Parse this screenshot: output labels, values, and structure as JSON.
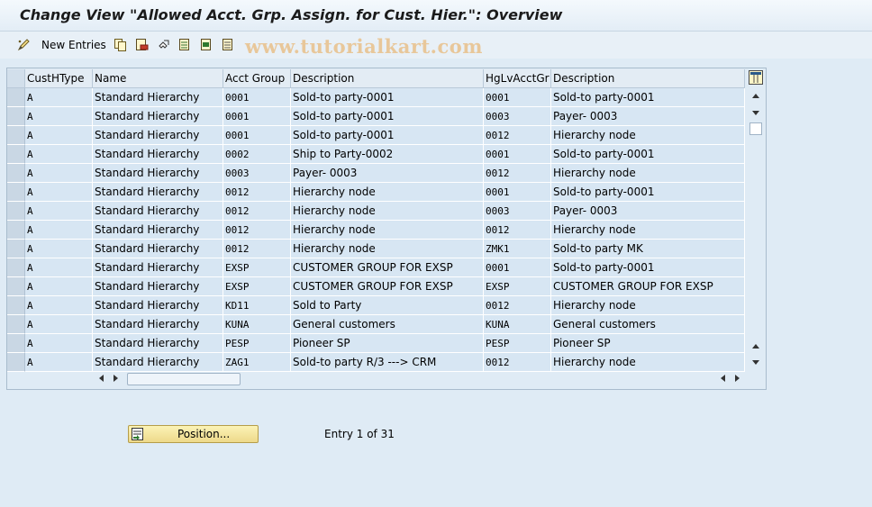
{
  "window": {
    "title": "Change View \"Allowed Acct. Grp. Assign. for Cust. Hier.\": Overview"
  },
  "toolbar": {
    "new_entries_label": "New Entries",
    "icons": [
      "edit-toggle-icon",
      "copy-icon",
      "delete-icon",
      "undo-icon",
      "select-all-icon",
      "select-block-icon",
      "deselect-all-icon"
    ]
  },
  "watermark": "www.tutorialkart.com",
  "table": {
    "columns": [
      "CustHType",
      "Name",
      "Acct Group",
      "Description",
      "HgLvAcctGr",
      "Description"
    ],
    "rows": [
      [
        "A",
        "Standard Hierarchy",
        "0001",
        "Sold-to party-0001",
        "0001",
        "Sold-to party-0001"
      ],
      [
        "A",
        "Standard Hierarchy",
        "0001",
        "Sold-to party-0001",
        "0003",
        "Payer- 0003"
      ],
      [
        "A",
        "Standard Hierarchy",
        "0001",
        "Sold-to party-0001",
        "0012",
        "Hierarchy node"
      ],
      [
        "A",
        "Standard Hierarchy",
        "0002",
        "Ship to Party-0002",
        "0001",
        "Sold-to party-0001"
      ],
      [
        "A",
        "Standard Hierarchy",
        "0003",
        "Payer- 0003",
        "0012",
        "Hierarchy node"
      ],
      [
        "A",
        "Standard Hierarchy",
        "0012",
        "Hierarchy node",
        "0001",
        "Sold-to party-0001"
      ],
      [
        "A",
        "Standard Hierarchy",
        "0012",
        "Hierarchy node",
        "0003",
        "Payer- 0003"
      ],
      [
        "A",
        "Standard Hierarchy",
        "0012",
        "Hierarchy node",
        "0012",
        "Hierarchy node"
      ],
      [
        "A",
        "Standard Hierarchy",
        "0012",
        "Hierarchy node",
        "ZMK1",
        "Sold-to party MK"
      ],
      [
        "A",
        "Standard Hierarchy",
        "EXSP",
        "CUSTOMER GROUP FOR EXSP",
        "0001",
        "Sold-to party-0001"
      ],
      [
        "A",
        "Standard Hierarchy",
        "EXSP",
        "CUSTOMER GROUP FOR EXSP",
        "EXSP",
        "CUSTOMER GROUP FOR EXSP"
      ],
      [
        "A",
        "Standard Hierarchy",
        "KD11",
        "Sold to Party",
        "0012",
        "Hierarchy node"
      ],
      [
        "A",
        "Standard Hierarchy",
        "KUNA",
        "General customers",
        "KUNA",
        "General customers"
      ],
      [
        "A",
        "Standard Hierarchy",
        "PESP",
        "Pioneer SP",
        "PESP",
        "Pioneer SP"
      ],
      [
        "A",
        "Standard Hierarchy",
        "ZAG1",
        " Sold-to party R/3 ---> CRM",
        "0012",
        "Hierarchy node"
      ]
    ]
  },
  "footer": {
    "position_button_label": "Position...",
    "entry_info": "Entry 1 of 31"
  },
  "colors": {
    "background": "#dfebf5",
    "row_background": "#d7e6f3",
    "position_button": "#f3e29c"
  }
}
